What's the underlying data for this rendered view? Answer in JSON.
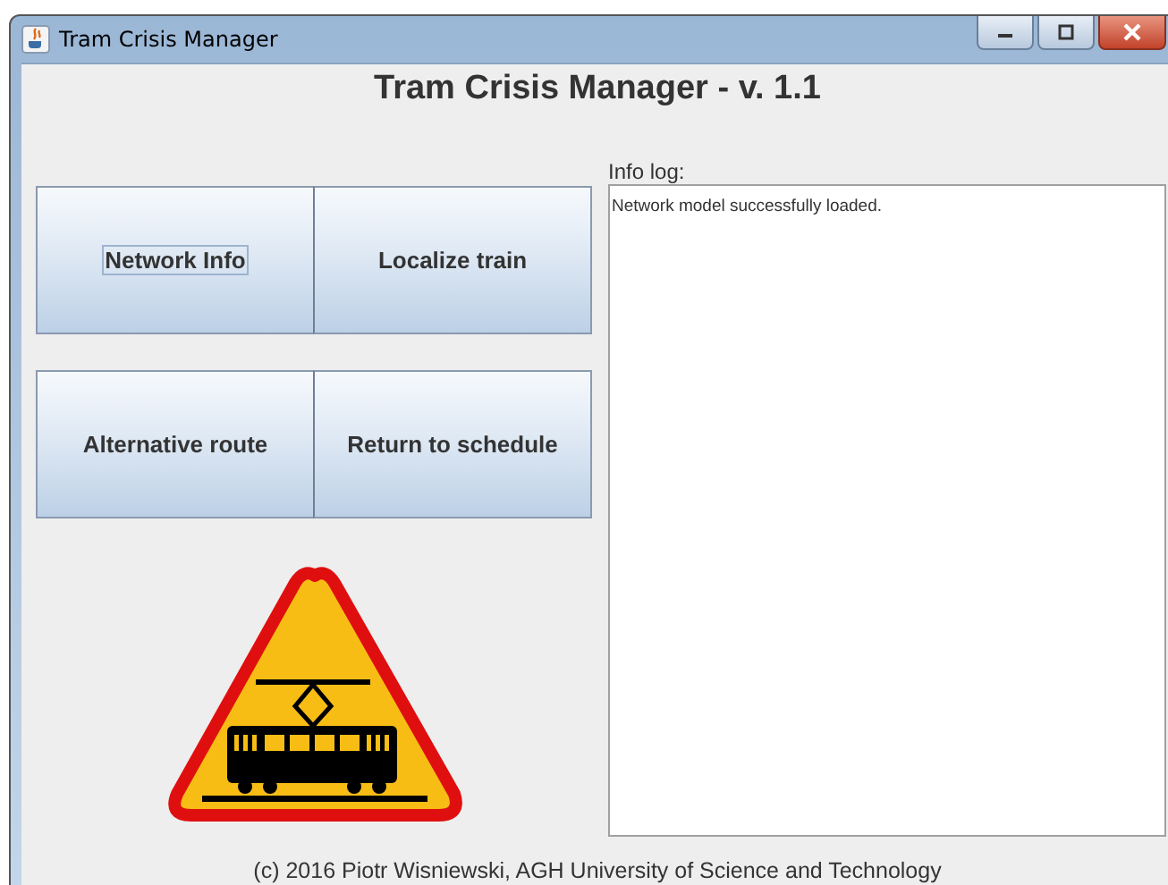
{
  "window": {
    "title": "Tram Crisis Manager"
  },
  "heading": "Tram Crisis Manager - v. 1.1",
  "buttons": [
    {
      "label": "Network Info",
      "focused": true
    },
    {
      "label": "Localize train",
      "focused": false
    },
    {
      "label": "Alternative route",
      "focused": false
    },
    {
      "label": "Return to schedule",
      "focused": false
    }
  ],
  "info_log": {
    "label": "Info log:",
    "text": "Network model successfully loaded."
  },
  "footer": "(c) 2016 Piotr Wisniewski, AGH University of Science and Technology"
}
